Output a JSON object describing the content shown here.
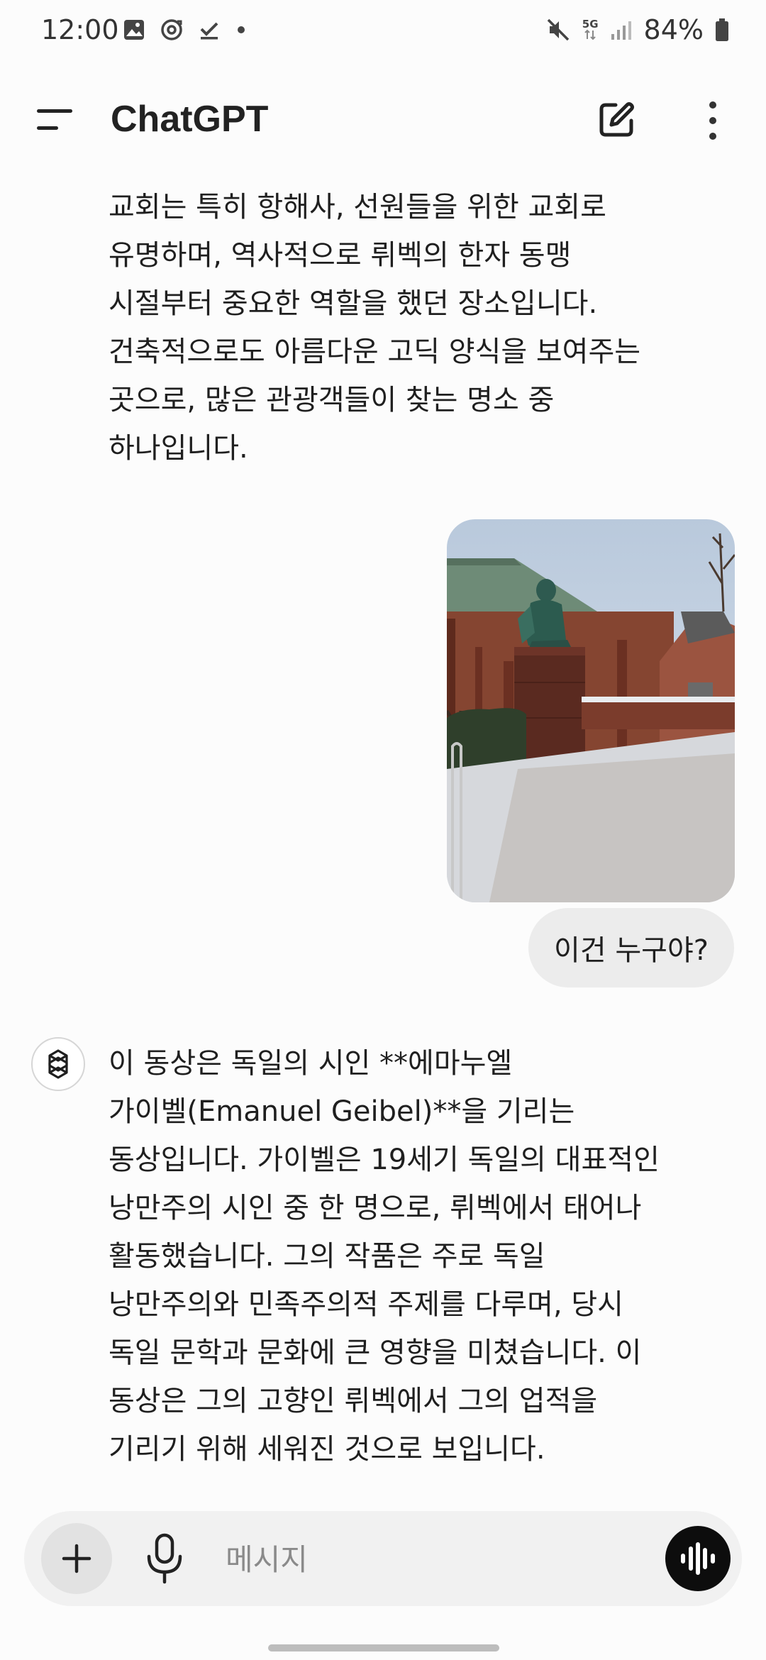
{
  "status_bar": {
    "time": "12:00",
    "battery_percent": "84%",
    "network": "5G",
    "icons": [
      "gallery-icon",
      "sync-icon",
      "check-icon",
      "dot-icon",
      "mute-icon",
      "signal-icon",
      "battery-icon"
    ]
  },
  "app_bar": {
    "title": "ChatGPT",
    "icons": [
      "menu-icon",
      "edit-icon",
      "more-vert-icon"
    ]
  },
  "messages": {
    "ai_1": {
      "lines": [
        "교회는 특히 항해사, 선원들을 위한 교회로",
        "유명하며, 역사적으로 뤼벡의 한자 동맹",
        "시절부터 중요한 역할을 했던 장소입니다.",
        "건축적으로도 아름다운 고딕 양식을 보여주는",
        "곳으로, 많은 관광객들이 찾는 명소 중",
        "하나입니다."
      ]
    },
    "user_1": {
      "text": "이건 누구야?",
      "image_subject": "statue-photo"
    },
    "ai_2": {
      "lines": [
        "이 동상은 독일의 시인 **에마누엘",
        "가이벨(Emanuel Geibel)**을 기리는",
        "동상입니다. 가이벨은 19세기 독일의 대표적인",
        "낭만주의 시인 중 한 명으로, 뤼벡에서 태어나",
        "활동했습니다. 그의 작품은 주로 독일",
        "낭만주의와 민족주의적 주제를 다루며, 당시",
        "독일 문학과 문화에 큰 영향을 미쳤습니다. 이",
        "동상은 그의 고향인 뤼벡에서 그의 업적을",
        "기리기 위해 세워진 것으로 보입니다."
      ]
    }
  },
  "composer": {
    "placeholder": "메시지",
    "icons": [
      "plus-icon",
      "mic-icon",
      "voice-waveform-icon"
    ]
  },
  "colors": {
    "background": "#fcfcfc",
    "text": "#1f1f1f",
    "bubble": "#ececec",
    "composer": "#f1f1f1",
    "voice_button": "#0d0d0d"
  }
}
